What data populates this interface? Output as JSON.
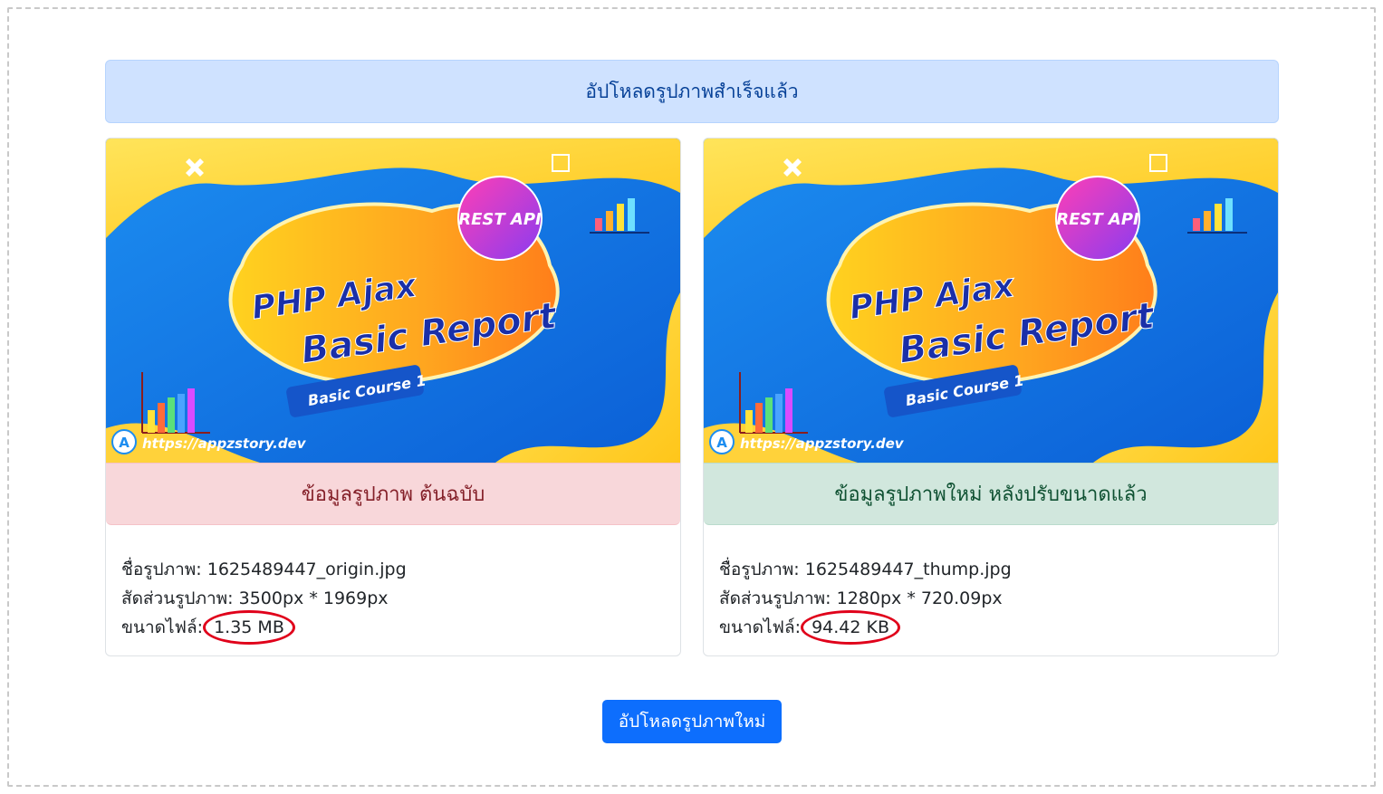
{
  "status": {
    "message": "อัปโหลดรูปภาพสำเร็จแล้ว"
  },
  "banner": {
    "rest_api": "REST API",
    "title_line1": "PHP Ajax",
    "title_line2": "Basic Report",
    "course": "Basic Course 1",
    "url": "https://appzstory.dev",
    "logo_letter": "A"
  },
  "original": {
    "heading": "ข้อมูลรูปภาพ ต้นฉบับ",
    "name_label": "ชื่อรูปภาพ: ",
    "name_value": "1625489447_origin.jpg",
    "ratio_label": "สัดส่วนรูปภาพ: ",
    "ratio_value": "3500px * 1969px",
    "size_label": "ขนาดไฟล์: ",
    "size_value": "1.35 MB"
  },
  "resized": {
    "heading": "ข้อมูลรูปภาพใหม่ หลังปรับขนาดแล้ว",
    "name_label": "ชื่อรูปภาพ: ",
    "name_value": "1625489447_thump.jpg",
    "ratio_label": "สัดส่วนรูปภาพ: ",
    "ratio_value": "1280px * 720.09px",
    "size_label": "ขนาดไฟล์: ",
    "size_value": "94.42 KB"
  },
  "actions": {
    "upload_new": "อัปโหลดรูปภาพใหม่"
  },
  "colors": {
    "primary": "#0d6efd",
    "info_bg": "#cfe2ff",
    "danger_bg": "#f8d7da",
    "success_bg": "#d1e7dd",
    "highlight_circle": "#e0001a"
  }
}
